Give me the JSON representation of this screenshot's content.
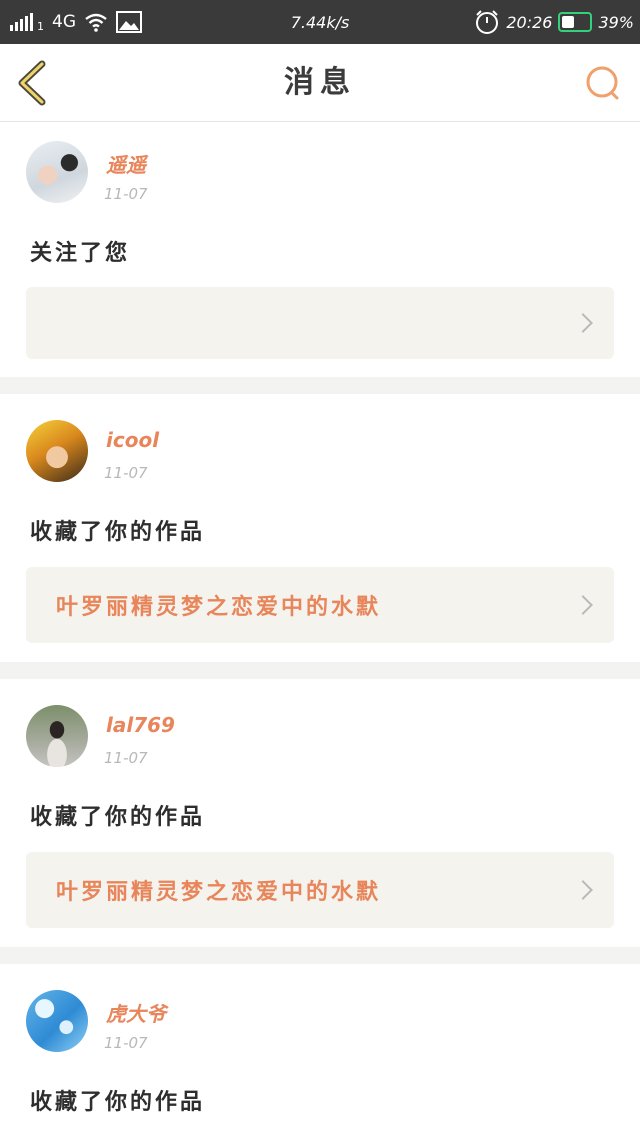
{
  "status_bar": {
    "carrier_sub": "1",
    "network": "4G",
    "speed": "7.44k/s",
    "time": "20:26",
    "battery": "39%",
    "battery_color": "#33d17a"
  },
  "header": {
    "title": "消息",
    "back_icon": "chevron-left-icon",
    "search_icon": "search-icon",
    "accent_color": "#e8855a"
  },
  "notifications": [
    {
      "user": "遥遥",
      "date": "11-07",
      "action": "关注了您",
      "reference": ""
    },
    {
      "user": "icool",
      "date": "11-07",
      "action": "收藏了你的作品",
      "reference": "叶罗丽精灵梦之恋爱中的水默"
    },
    {
      "user": "lal769",
      "date": "11-07",
      "action": "收藏了你的作品",
      "reference": "叶罗丽精灵梦之恋爱中的水默"
    },
    {
      "user": "虎大爷",
      "date": "11-07",
      "action": "收藏了你的作品",
      "reference": ""
    }
  ]
}
